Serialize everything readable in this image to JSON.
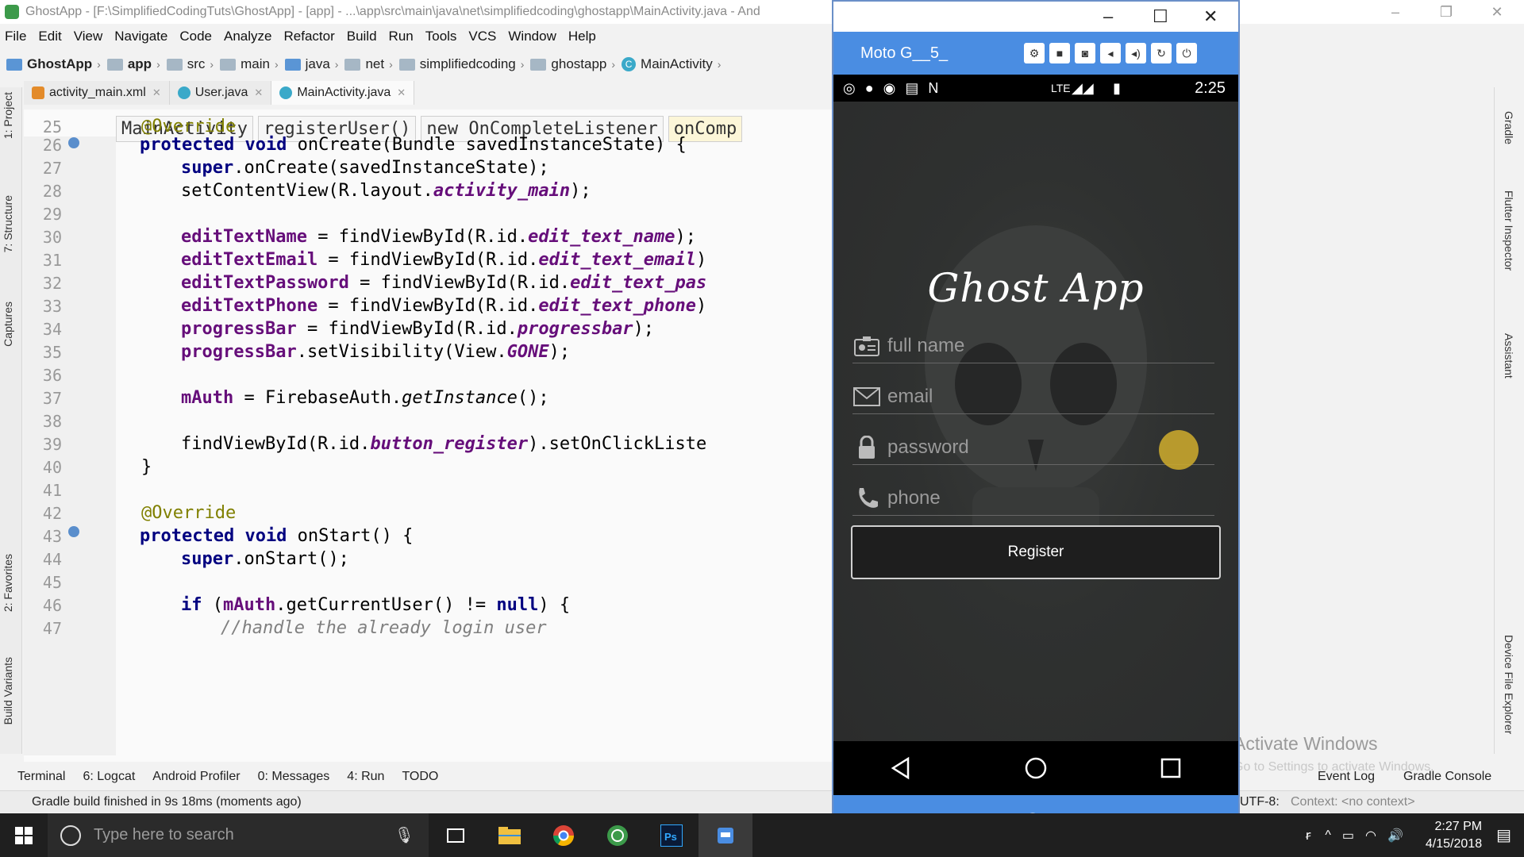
{
  "ide": {
    "title": "GhostApp - [F:\\SimplifiedCodingTuts\\GhostApp] - [app] - ...\\app\\src\\main\\java\\net\\simplifiedcoding\\ghostapp\\MainActivity.java - And",
    "menu": [
      "File",
      "Edit",
      "View",
      "Navigate",
      "Code",
      "Analyze",
      "Refactor",
      "Build",
      "Run",
      "Tools",
      "VCS",
      "Window",
      "Help"
    ],
    "breadcrumbs": [
      "GhostApp",
      "app",
      "src",
      "main",
      "java",
      "net",
      "simplifiedcoding",
      "ghostapp",
      "MainActivity"
    ],
    "tabs": [
      {
        "label": "activity_main.xml"
      },
      {
        "label": "User.java"
      },
      {
        "label": "MainActivity.java"
      }
    ],
    "code_breadcrumbs": [
      "MainActivity",
      "registerUser()",
      "new OnCompleteListener",
      "onComp"
    ],
    "left_tools": [
      "1: Project",
      "7: Structure",
      "Captures",
      "2: Favorites",
      "Build Variants"
    ],
    "right_tools": [
      "Gradle",
      "Flutter Inspector",
      "Assistant",
      "Device File Explorer"
    ],
    "code": {
      "l25": "25",
      "l26": "26",
      "l27": "27",
      "l28": "28",
      "l29": "29",
      "l30": "30",
      "l31": "31",
      "l32": "32",
      "l33": "33",
      "l34": "34",
      "l35": "35",
      "l36": "36",
      "l37": "37",
      "l38": "38",
      "l39": "39",
      "l40": "40",
      "l41": "41",
      "l42": "42",
      "l43": "43",
      "l44": "44",
      "l45": "45",
      "l46": "46",
      "l47": "47"
    },
    "bottom_tools": [
      "Terminal",
      "6: Logcat",
      "Android Profiler",
      "0: Messages",
      "4: Run",
      "TODO"
    ],
    "bottom_right": [
      "Event Log",
      "Gradle Console"
    ],
    "status": "Gradle build finished in 9s 18ms (moments ago)",
    "encoding": "UTF-8:",
    "context": "Context: <no context>"
  },
  "emulator": {
    "name": "Moto G__5_",
    "status_time": "2:25",
    "status_network": "LTE",
    "app_title": "Ghost App",
    "fields": {
      "name_placeholder": "full name",
      "email_placeholder": "email",
      "password_placeholder": "password",
      "phone_placeholder": "phone"
    },
    "register_label": "Register"
  },
  "watermark": {
    "line1": "Activate Windows",
    "line2": "Go to Settings to activate Windows."
  },
  "taskbar": {
    "search_placeholder": "Type here to search",
    "time": "2:27 PM",
    "date": "4/15/2018"
  }
}
